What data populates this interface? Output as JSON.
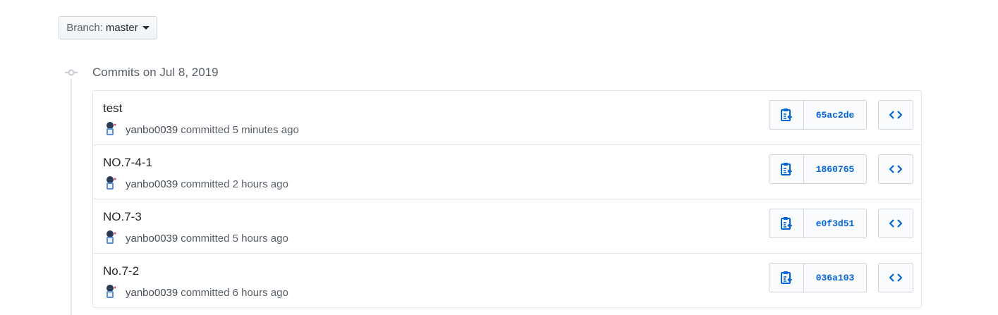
{
  "branch": {
    "prefix": "Branch:",
    "name": "master"
  },
  "group": {
    "title": "Commits on Jul 8, 2019"
  },
  "commits": [
    {
      "title": "test",
      "author": "yanbo0039",
      "time": "committed 5 minutes ago",
      "sha": "65ac2de"
    },
    {
      "title": "NO.7-4-1",
      "author": "yanbo0039",
      "time": "committed 2 hours ago",
      "sha": "1860765"
    },
    {
      "title": "NO.7-3",
      "author": "yanbo0039",
      "time": "committed 5 hours ago",
      "sha": "e0f3d51"
    },
    {
      "title": "No.7-2",
      "author": "yanbo0039",
      "time": "committed 6 hours ago",
      "sha": "036a103"
    }
  ],
  "icons": {
    "copy": "clipboard-icon",
    "browse": "code-icon",
    "commit": "git-commit-icon"
  },
  "colors": {
    "link": "#0366d6",
    "muted": "#586069",
    "border": "#e1e4e8"
  }
}
